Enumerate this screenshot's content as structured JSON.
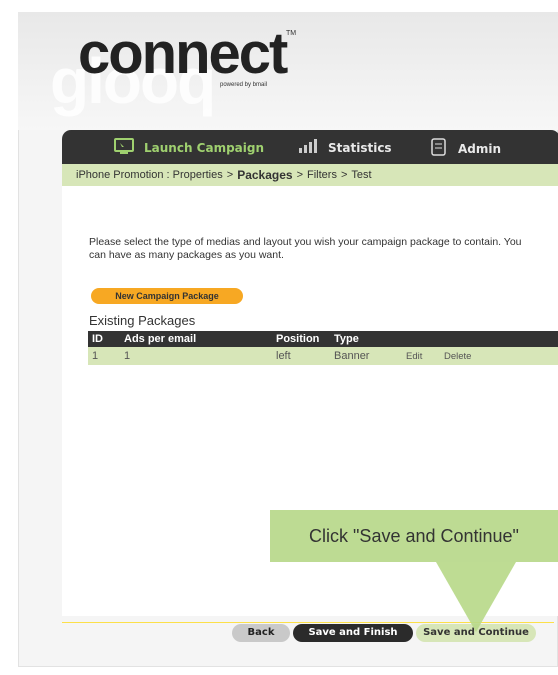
{
  "logo": {
    "main": "connect",
    "secondary": "glooq",
    "tm": "TM",
    "powered_by": "powered by bmail"
  },
  "nav": {
    "items": [
      {
        "label": "Launch Campaign",
        "icon": "monitor-icon"
      },
      {
        "label": "Statistics",
        "icon": "bar-chart-icon"
      },
      {
        "label": "Admin",
        "icon": "document-icon"
      }
    ]
  },
  "breadcrumb": {
    "items": [
      "iPhone Promotion : Properties",
      "Packages",
      "Filters",
      "Test"
    ],
    "separator": ">",
    "current_index": 1
  },
  "intro": "Please select the type of medias and layout you wish your campaign package to contain. You can have as many packages as you want.",
  "new_package_button": "New Campaign Package",
  "existing_title": "Existing Packages",
  "table": {
    "headers": [
      "ID",
      "Ads per email",
      "Position",
      "Type",
      "",
      ""
    ],
    "rows": [
      {
        "id": "1",
        "ads": "1",
        "position": "left",
        "type": "Banner",
        "edit": "Edit",
        "delete": "Delete"
      }
    ]
  },
  "buttons": {
    "back": "Back",
    "save_finish": "Save and Finish",
    "save_continue": "Save and Continue"
  },
  "callout": "Click \"Save and Continue\"",
  "colors": {
    "nav_bg": "#333333",
    "accent_green": "#d7e6b8",
    "highlight_green": "#9fd06f",
    "orange": "#f7a823",
    "callout": "#b8d98a"
  }
}
